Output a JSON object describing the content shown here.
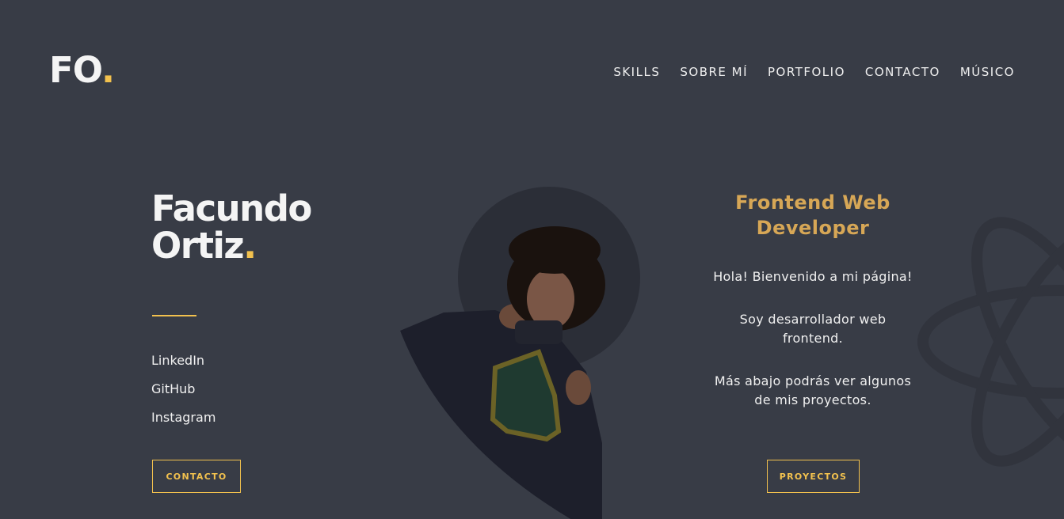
{
  "colors": {
    "background": "#383c46",
    "accent": "#f2c14e",
    "role": "#d7a756",
    "photo_circle": "#2b2e37"
  },
  "header": {
    "logo_text": "FO",
    "logo_dot": ".",
    "nav": [
      {
        "label": "SKILLS"
      },
      {
        "label": "SOBRE MÍ"
      },
      {
        "label": "PORTFOLIO"
      },
      {
        "label": "CONTACTO"
      },
      {
        "label": "MÚSICO"
      }
    ]
  },
  "hero": {
    "first_name": "Facundo",
    "last_name": "Ortiz",
    "name_dot": ".",
    "social_links": [
      {
        "label": "LinkedIn"
      },
      {
        "label": "GitHub"
      },
      {
        "label": "Instagram"
      }
    ],
    "contact_button": "CONTACTO",
    "role_line1": "Frontend Web",
    "role_line2": "Developer",
    "bio": [
      "Hola! Bienvenido a mi página!",
      "Soy desarrollador web frontend.",
      "Más abajo podrás ver algunos de mis proyectos."
    ],
    "projects_button": "PROYECTOS"
  },
  "icons": {
    "decorative": "react-atom-icon",
    "portrait": "profile-photo"
  }
}
